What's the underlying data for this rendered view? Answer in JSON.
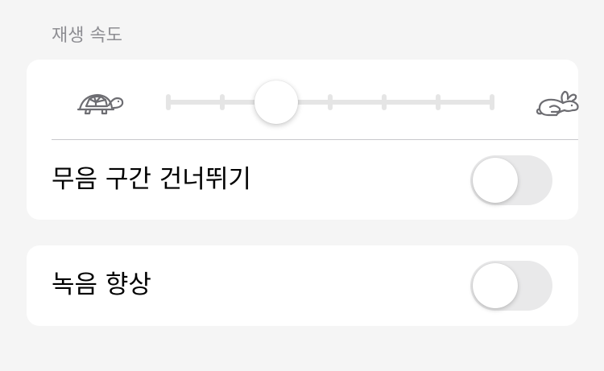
{
  "playback_speed": {
    "section_title": "재생 속도",
    "slow_icon": "turtle-icon",
    "fast_icon": "rabbit-icon",
    "slider": {
      "step_count": 7,
      "selected_step_index": 2
    },
    "skip_silence": {
      "label": "무음 구간 건너뛰기",
      "enabled": false
    }
  },
  "enhance_recording": {
    "label": "녹음 향상",
    "enabled": false
  },
  "colors": {
    "background": "#f5f5f5",
    "card": "#ffffff",
    "track": "#e5e5e5",
    "toggle_off": "#e9e9ea",
    "section_header": "#8e8e93",
    "icon": "#6d6d72"
  }
}
